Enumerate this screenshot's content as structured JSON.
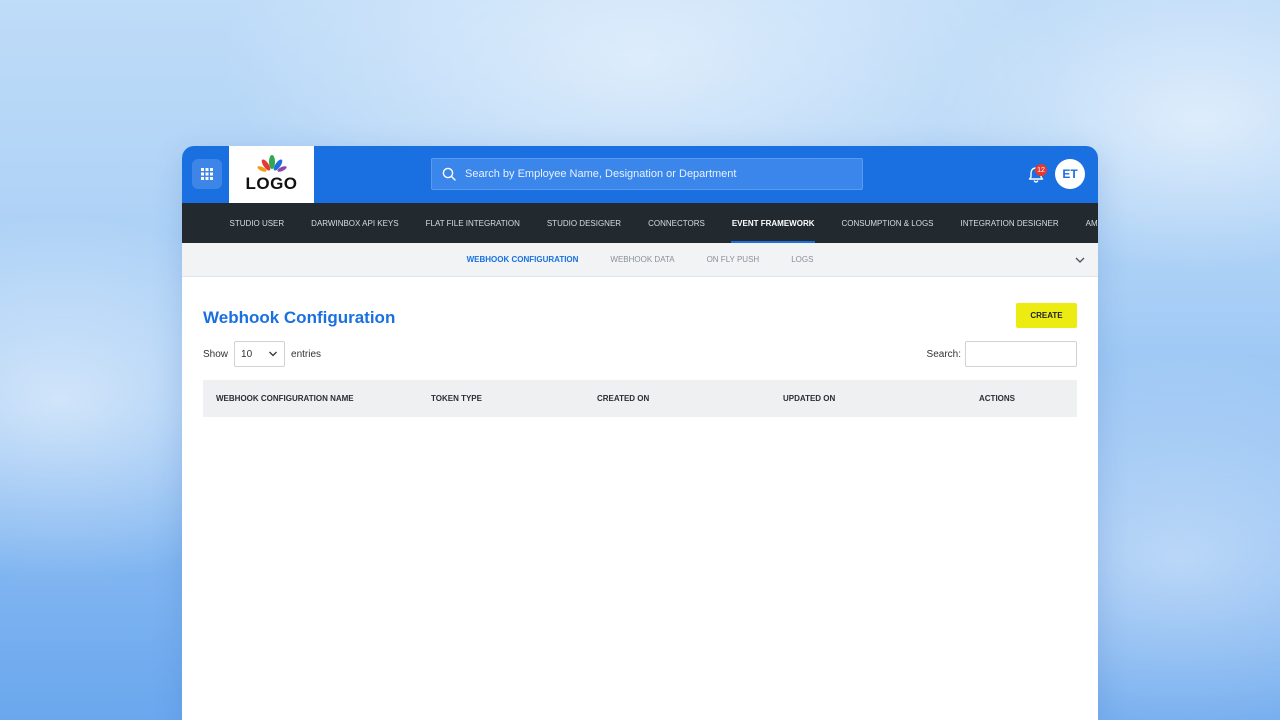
{
  "header": {
    "logo_text": "LOGO",
    "search_placeholder": "Search by Employee Name, Designation or Department",
    "notification_count": "12",
    "avatar_initials": "ET",
    "brand_color": "#1a70e0"
  },
  "main_nav": {
    "items": [
      {
        "label": "STUDIO USER"
      },
      {
        "label": "DARWINBOX API KEYS"
      },
      {
        "label": "FLAT FILE INTEGRATION"
      },
      {
        "label": "STUDIO DESIGNER"
      },
      {
        "label": "CONNECTORS"
      },
      {
        "label": "EVENT FRAMEWORK",
        "active": true
      },
      {
        "label": "CONSUMPTION & LOGS"
      },
      {
        "label": "INTEGRATION DESIGNER"
      },
      {
        "label": "AMPLIFY SCRIPTS"
      }
    ]
  },
  "sub_nav": {
    "items": [
      {
        "label": "WEBHOOK CONFIGURATION",
        "active": true
      },
      {
        "label": "WEBHOOK DATA"
      },
      {
        "label": "ON FLY PUSH"
      },
      {
        "label": "LOGS"
      }
    ]
  },
  "page": {
    "title": "Webhook Configuration",
    "create_label": "CREATE",
    "create_color": "#ecec13",
    "show_label": "Show",
    "entries_value": "10",
    "entries_label": "entries",
    "search_label": "Search:",
    "search_value": ""
  },
  "table": {
    "columns": [
      "WEBHOOK CONFIGURATION NAME",
      "TOKEN TYPE",
      "CREATED ON",
      "UPDATED ON",
      "ACTIONS"
    ],
    "rows": []
  }
}
